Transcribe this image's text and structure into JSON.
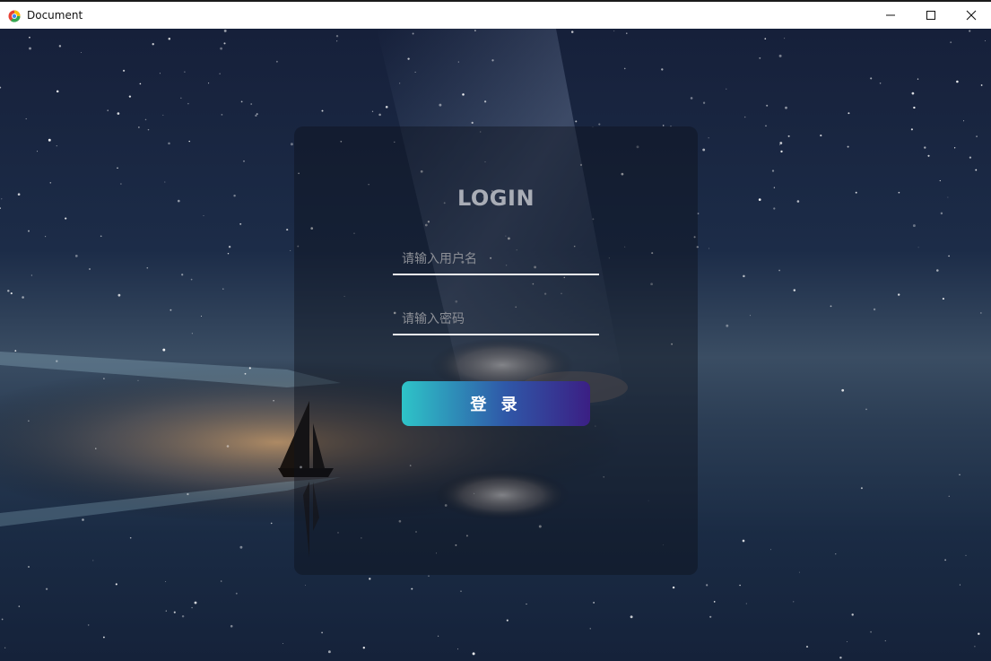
{
  "window": {
    "title": "Document",
    "icon": "browser-app-icon",
    "controls": [
      "minimize-icon",
      "maximize-icon",
      "close-icon"
    ]
  },
  "login": {
    "title": "LOGIN",
    "username_placeholder": "请输入用户名",
    "username_value": "",
    "password_placeholder": "请输入密码",
    "password_value": "",
    "submit_label": "登 录"
  },
  "colors": {
    "button_gradient_start": "#2ec4c8",
    "button_gradient_end": "#3b1f84",
    "title_color": "#a9adb6",
    "sky_dark": "#0d1626"
  }
}
